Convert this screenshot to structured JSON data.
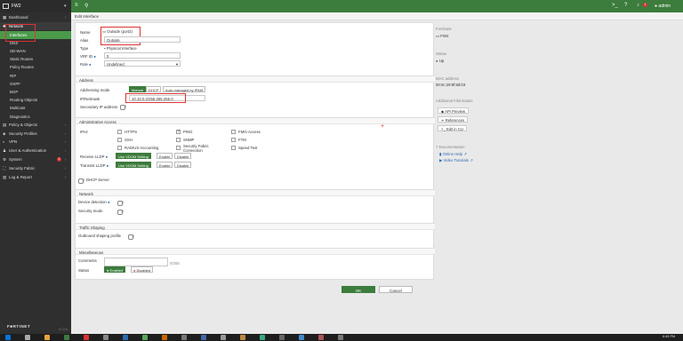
{
  "topbar": {
    "brand": "FW2",
    "admin": "admin",
    "alerts": "1"
  },
  "sidebar": {
    "items": [
      {
        "label": "Dashboard",
        "level": 0,
        "state": "normal",
        "chevron": true
      },
      {
        "label": "Network",
        "level": 0,
        "state": "open",
        "chevron": false
      },
      {
        "label": "Interfaces",
        "level": 1,
        "state": "active",
        "chevron": false
      },
      {
        "label": "DNS",
        "level": 1,
        "state": "normal",
        "chevron": false
      },
      {
        "label": "SD-WAN",
        "level": 1,
        "state": "normal",
        "chevron": false
      },
      {
        "label": "Static Routes",
        "level": 1,
        "state": "normal",
        "chevron": false
      },
      {
        "label": "Policy Routes",
        "level": 1,
        "state": "normal",
        "chevron": false
      },
      {
        "label": "RIP",
        "level": 1,
        "state": "normal",
        "chevron": false
      },
      {
        "label": "OSPF",
        "level": 1,
        "state": "normal",
        "chevron": false
      },
      {
        "label": "BGP",
        "level": 1,
        "state": "normal",
        "chevron": false
      },
      {
        "label": "Routing Objects",
        "level": 1,
        "state": "normal",
        "chevron": false
      },
      {
        "label": "Multicast",
        "level": 1,
        "state": "normal",
        "chevron": false
      },
      {
        "label": "Diagnostics",
        "level": 1,
        "state": "normal",
        "chevron": false
      },
      {
        "label": "Policy & Objects",
        "level": 0,
        "state": "normal",
        "chevron": true
      },
      {
        "label": "Security Profiles",
        "level": 0,
        "state": "normal",
        "chevron": true
      },
      {
        "label": "VPN",
        "level": 0,
        "state": "normal",
        "chevron": true
      },
      {
        "label": "User & Authentication",
        "level": 0,
        "state": "normal",
        "chevron": true
      },
      {
        "label": "System",
        "level": 0,
        "state": "normal",
        "chevron": true,
        "badge": "1"
      },
      {
        "label": "Security Fabric",
        "level": 0,
        "state": "normal",
        "chevron": true
      },
      {
        "label": "Log & Report",
        "level": 0,
        "state": "normal",
        "chevron": true
      }
    ],
    "footer_brand": "F■RTINET",
    "version": "v7.2.0"
  },
  "page": {
    "title": "Edit Interface"
  },
  "form": {
    "name_label": "Name",
    "name_value": "Outside (port2)",
    "alias_label": "Alias",
    "alias_value": "Outside",
    "type_label": "Type",
    "type_value": "Physical Interface",
    "vrf_label": "VRF ID",
    "vrf_value": "0",
    "role_label": "Role",
    "role_value": "Undefined",
    "address_section": "Address",
    "addr_mode_label": "Addressing mode",
    "addr_modes": [
      "Manual",
      "DHCP",
      "Auto-managed by IPAM"
    ],
    "ip_label": "IP/Netmask",
    "ip_value": "10.10.0.2/255.255.255.0",
    "secondary_label": "Secondary IP address",
    "admin_section": "Administrative Access",
    "ipv4_label": "IPv4",
    "access": [
      {
        "label": "HTTPS",
        "checked": false
      },
      {
        "label": "PING",
        "checked": true
      },
      {
        "label": "FMG-Access",
        "checked": false
      },
      {
        "label": "SSH",
        "checked": false
      },
      {
        "label": "SNMP",
        "checked": false
      },
      {
        "label": "FTM",
        "checked": false
      },
      {
        "label": "RADIUS Accounting",
        "checked": false
      },
      {
        "label": "Security Fabric Connection",
        "checked": false
      },
      {
        "label": "Speed Test",
        "checked": false
      }
    ],
    "receive_lldp_label": "Receive LLDP",
    "transmit_lldp_label": "Transmit LLDP",
    "lldp_opts": [
      "Use VDOM Setting",
      "Enable",
      "Disable"
    ],
    "dhcp_server_label": "DHCP Server",
    "network_section": "Network",
    "device_detection_label": "Device detection",
    "security_mode_label": "Security mode",
    "traffic_section": "Traffic Shaping",
    "outbound_label": "Outbound shaping profile",
    "misc_section": "Miscellaneous",
    "comments_label": "Comments",
    "comments_count": "0/255",
    "status_label": "Status",
    "status_enabled": "Enabled",
    "status_disabled": "Disabled",
    "ok_label": "OK",
    "cancel_label": "Cancel"
  },
  "right": {
    "fortigate_header": "FortiGate",
    "fortigate_value": "FW2",
    "status_header": "Status",
    "status_value": "Up",
    "mac_header": "MAC address",
    "mac_value": "00:0c:29:9f:8d:03",
    "addl_header": "Additional Information",
    "api_preview": "API Preview",
    "references": "References",
    "edit_cli": "Edit in CLI",
    "docs_header": "Documentation",
    "online_help": "Online Help",
    "video_tutorials": "Video Tutorials"
  },
  "taskbar": {
    "time": "6:45 PM"
  },
  "colors": {
    "brand_green": "#3c7c3c",
    "sidebar_bg": "#2f2f2f",
    "highlight_red": "#d33333"
  }
}
